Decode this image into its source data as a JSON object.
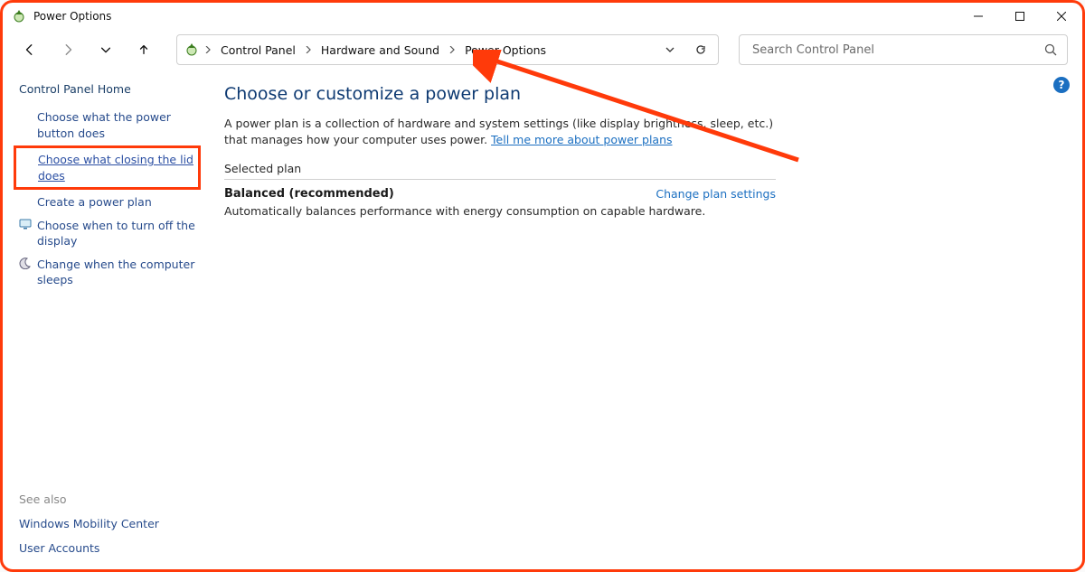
{
  "window": {
    "title": "Power Options"
  },
  "breadcrumb": {
    "items": [
      "Control Panel",
      "Hardware and Sound",
      "Power Options"
    ]
  },
  "search": {
    "placeholder": "Search Control Panel"
  },
  "sidebar": {
    "header": "Control Panel Home",
    "items": [
      {
        "label": "Choose what the power button does"
      },
      {
        "label": "Choose what closing the lid does"
      },
      {
        "label": "Create a power plan"
      },
      {
        "label": "Choose when to turn off the display"
      },
      {
        "label": "Change when the computer sleeps"
      }
    ],
    "see_also_label": "See also",
    "see_also": [
      {
        "label": "Windows Mobility Center"
      },
      {
        "label": "User Accounts"
      }
    ]
  },
  "main": {
    "heading": "Choose or customize a power plan",
    "description_pre": "A power plan is a collection of hardware and system settings (like display brightness, sleep, etc.) that manages how your computer uses power. ",
    "description_link": "Tell me more about power plans",
    "selected_plan_label": "Selected plan",
    "plan": {
      "name": "Balanced (recommended)",
      "change_link": "Change plan settings",
      "description": "Automatically balances performance with energy consumption on capable hardware."
    }
  },
  "icons": {
    "display": "display-icon",
    "sleep": "moon-icon"
  },
  "colors": {
    "accent": "#1b6fc1",
    "heading": "#0e3a72",
    "annotation": "#ff3a0a"
  }
}
